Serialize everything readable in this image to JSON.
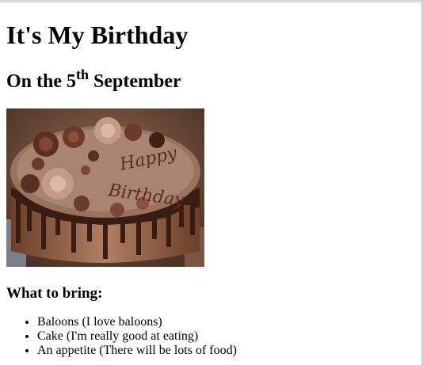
{
  "page": {
    "title": "It's My Birthday",
    "date_prefix": "On the 5",
    "date_suffix": "th",
    "date_month": "September"
  },
  "image": {
    "icon": "birthday-cake-photo",
    "cake_text_line1": "Happy",
    "cake_text_line2": "Birthday"
  },
  "bring": {
    "heading": "What to bring:",
    "items": [
      "Baloons (I love baloons)",
      "Cake (I'm really good at eating)",
      "An appetite (There will be lots of food)"
    ]
  }
}
